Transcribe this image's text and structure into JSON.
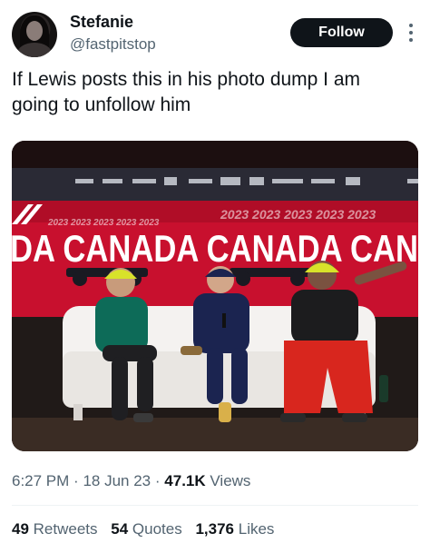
{
  "author": {
    "name": "Stefanie",
    "handle": "@fastpitstop",
    "avatar_icon": "profile-photo"
  },
  "follow_label": "Follow",
  "more_icon": "ellipsis-icon",
  "tweet": {
    "text": "If Lewis posts this in his photo dump I am going to unfollow him"
  },
  "media": {
    "banner_text": "DA CANADA CANADA CAN",
    "banner_repeat": "2023 2023 2023 2023 2023",
    "description_icon": "press-conference-photo"
  },
  "meta": {
    "time": "6:27 PM",
    "separator": "·",
    "date": "18 Jun 23",
    "views_count": "47.1K",
    "views_label": "Views"
  },
  "stats": {
    "retweets_count": "49",
    "retweets_label": "Retweets",
    "quotes_count": "54",
    "quotes_label": "Quotes",
    "likes_count": "1,376",
    "likes_label": "Likes"
  },
  "colors": {
    "text_primary": "#0f1419",
    "text_secondary": "#536471",
    "banner_red": "#c8102e",
    "sofa_white": "#f4f2f0"
  }
}
